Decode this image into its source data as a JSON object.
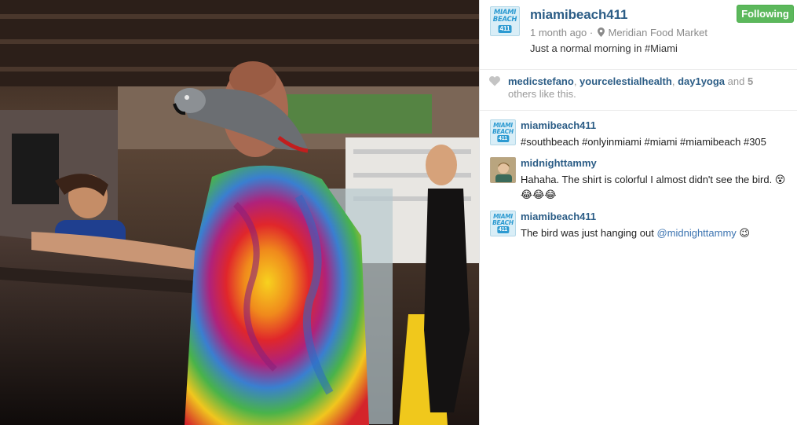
{
  "post": {
    "username": "miamibeach411",
    "follow_label": "Following",
    "time_ago": "1 month ago",
    "separator": "·",
    "location": "Meridian Food Market",
    "caption": "Just a normal morning in #Miami",
    "avatar_text": "MIAMI BEACH",
    "avatar_number": "411"
  },
  "likes": {
    "user1": "medicstefano",
    "user2": "yourcelestialhealth",
    "user3": "day1yoga",
    "and_text": "and",
    "count": "5",
    "tail": "others like this."
  },
  "comments": [
    {
      "user": "miamibeach411",
      "text": "#southbeach #onlyinmiami #miami #miamibeach #305"
    },
    {
      "user": "midnighttammy",
      "text": "Hahaha. The shirt is colorful I almost didn't see the bird. 😵😂😂😂"
    },
    {
      "user": "miamibeach411",
      "text": "The bird was just hanging out",
      "mention": "@midnighttammy",
      "emoji": "😉"
    }
  ],
  "colors": {
    "link": "#2c5d86",
    "follow_button": "#5cb85c",
    "muted": "#8a8a8a"
  },
  "icons": {
    "location": "map-pin-icon",
    "like": "heart-icon"
  }
}
